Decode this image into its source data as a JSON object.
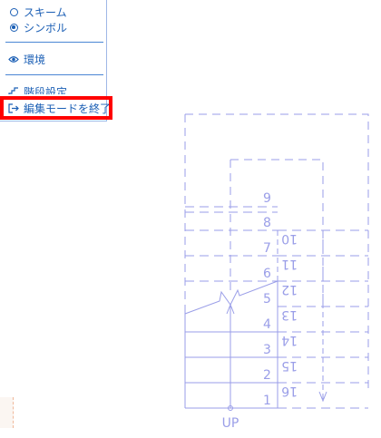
{
  "menu": {
    "scheme_label": "スキーム",
    "symbol_label": "シンボル",
    "environment_label": "環境",
    "stair_settings_label": "階段設定",
    "exit_edit_label": "編集モードを終了"
  },
  "drawing": {
    "left_steps": [
      "1",
      "2",
      "3",
      "4",
      "5",
      "6",
      "7",
      "8",
      "9"
    ],
    "right_steps": [
      "16",
      "15",
      "14",
      "13",
      "12",
      "11",
      "10"
    ],
    "up_label": "UP"
  },
  "colors": {
    "menu_text": "#1b5fb5",
    "line": "#9a9ee8",
    "highlight": "#ff0000"
  }
}
